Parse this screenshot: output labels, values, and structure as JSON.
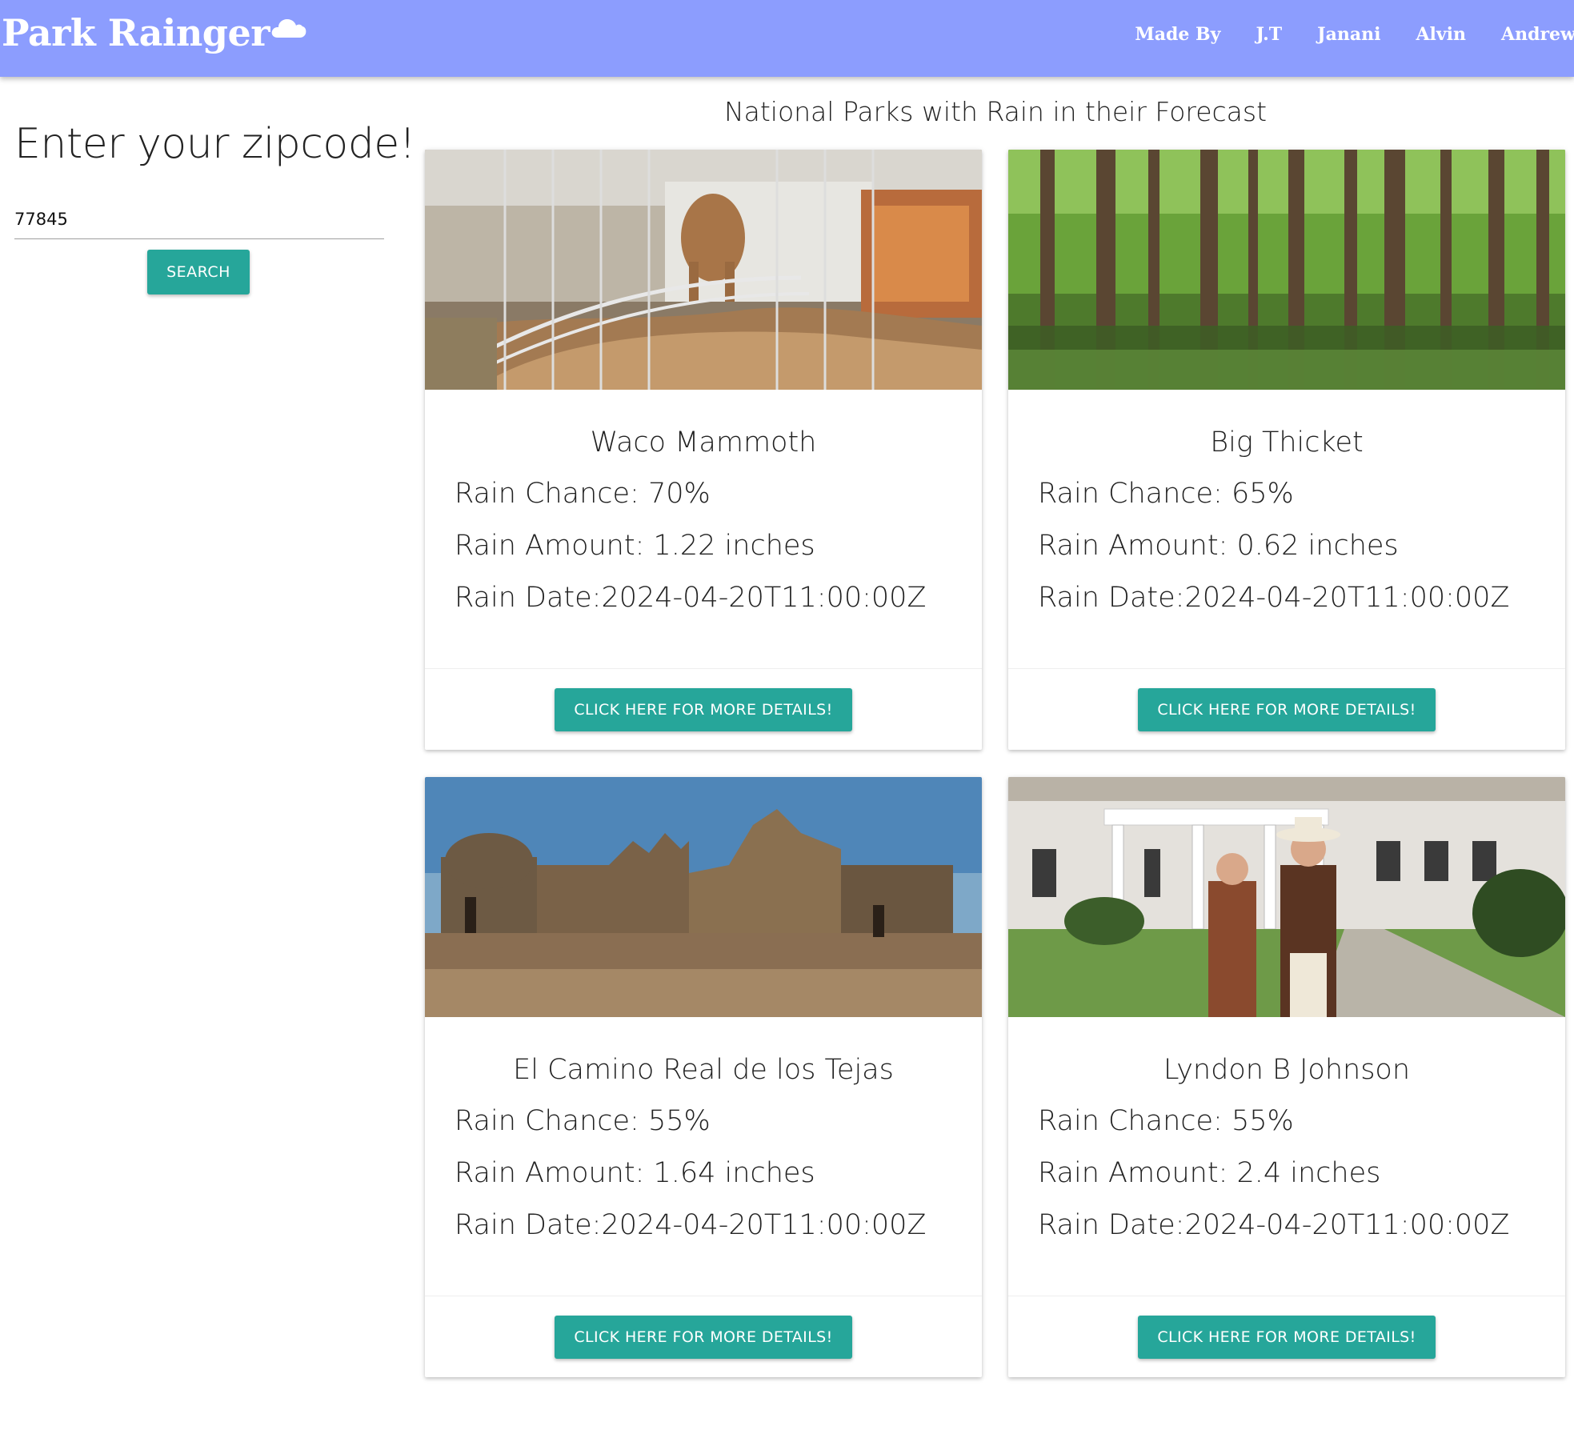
{
  "navbar": {
    "brand": "Park Rainger",
    "brand_icon": "cloud-icon",
    "links": [
      "Made By",
      "J.T",
      "Janani",
      "Alvin",
      "Andrew"
    ],
    "background": "#8c9dfe"
  },
  "sidebar": {
    "heading": "Enter your zipcode!",
    "zip_value": "77845",
    "search_label": "SEARCH"
  },
  "main": {
    "title": "National Parks with Rain in their Forecast"
  },
  "accent_color": "#26a69a",
  "parks": [
    {
      "name": "Waco Mammoth",
      "rain_chance": "Rain Chance: 70%",
      "rain_amount": "Rain Amount: 1.22 inches",
      "rain_date": "Rain Date:2024-04-20T11:00:00Z",
      "button": "CLICK HERE FOR MORE DETAILS!"
    },
    {
      "name": "Big Thicket",
      "rain_chance": "Rain Chance: 65%",
      "rain_amount": "Rain Amount: 0.62 inches",
      "rain_date": "Rain Date:2024-04-20T11:00:00Z",
      "button": "CLICK HERE FOR MORE DETAILS!"
    },
    {
      "name": "El Camino Real de los Tejas",
      "rain_chance": "Rain Chance: 55%",
      "rain_amount": "Rain Amount: 1.64 inches",
      "rain_date": "Rain Date:2024-04-20T11:00:00Z",
      "button": "CLICK HERE FOR MORE DETAILS!"
    },
    {
      "name": "Lyndon B Johnson",
      "rain_chance": "Rain Chance: 55%",
      "rain_amount": "Rain Amount: 2.4 inches",
      "rain_date": "Rain Date:2024-04-20T11:00:00Z",
      "button": "CLICK HERE FOR MORE DETAILS!"
    }
  ]
}
